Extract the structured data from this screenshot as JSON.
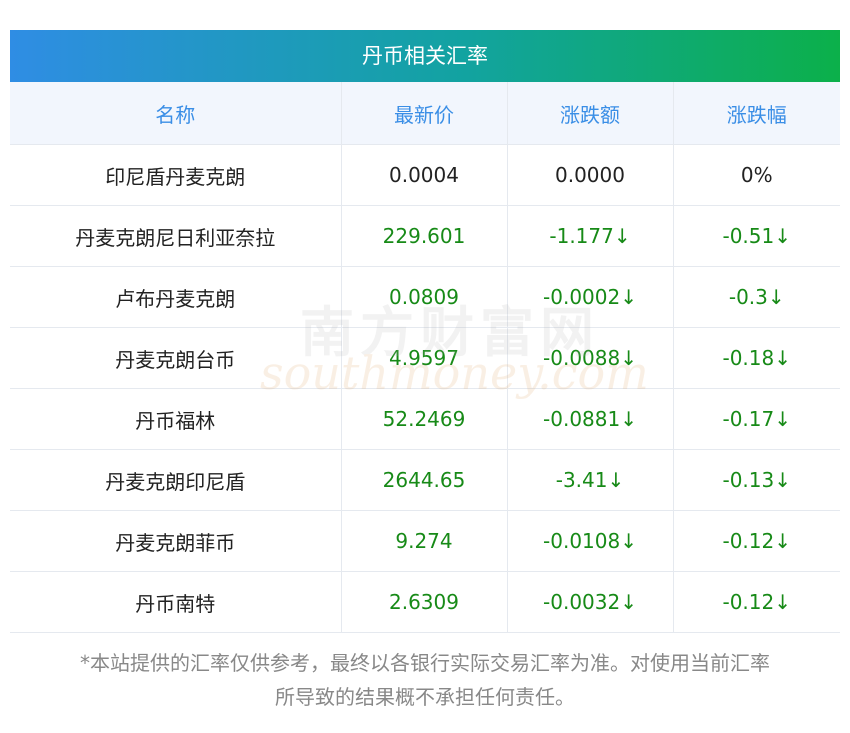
{
  "title": "丹币相关汇率",
  "headers": [
    "名称",
    "最新价",
    "涨跌额",
    "涨跌幅"
  ],
  "rows": [
    {
      "name": "印尼盾丹麦克朗",
      "price": "0.0004",
      "change": "0.0000",
      "pct": "0%",
      "trend": "flat"
    },
    {
      "name": "丹麦克朗尼日利亚奈拉",
      "price": "229.601",
      "change": "-1.177↓",
      "pct": "-0.51↓",
      "trend": "down"
    },
    {
      "name": "卢布丹麦克朗",
      "price": "0.0809",
      "change": "-0.0002↓",
      "pct": "-0.3↓",
      "trend": "down"
    },
    {
      "name": "丹麦克朗台币",
      "price": "4.9597",
      "change": "-0.0088↓",
      "pct": "-0.18↓",
      "trend": "down"
    },
    {
      "name": "丹币福林",
      "price": "52.2469",
      "change": "-0.0881↓",
      "pct": "-0.17↓",
      "trend": "down"
    },
    {
      "name": "丹麦克朗印尼盾",
      "price": "2644.65",
      "change": "-3.41↓",
      "pct": "-0.13↓",
      "trend": "down"
    },
    {
      "name": "丹麦克朗菲币",
      "price": "9.274",
      "change": "-0.0108↓",
      "pct": "-0.12↓",
      "trend": "down"
    },
    {
      "name": "丹币南特",
      "price": "2.6309",
      "change": "-0.0032↓",
      "pct": "-0.12↓",
      "trend": "down"
    }
  ],
  "watermark": {
    "cn": "南方财富网",
    "en": "southmoney.com"
  },
  "disclaimer": {
    "line1": "*本站提供的汇率仅供参考，最终以各银行实际交易汇率为准。对使用当前汇率",
    "line2": "所导致的结果概不承担任何责任。"
  },
  "colors": {
    "header_text": "#3a8ee6",
    "down": "#178a17",
    "title_start": "#2f8de4",
    "title_end": "#0cb04a"
  }
}
